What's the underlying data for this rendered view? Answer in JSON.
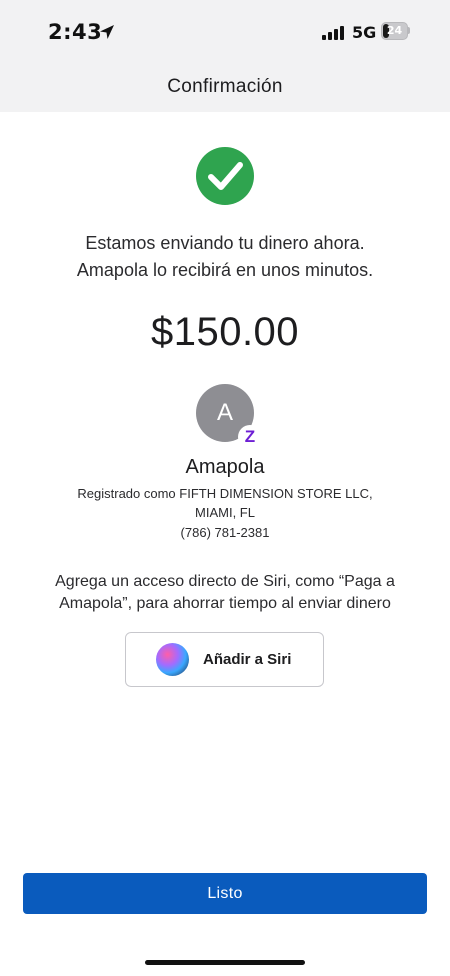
{
  "status_bar": {
    "time": "2:43",
    "network": "5G",
    "battery_level": "24",
    "battery_fraction": 0.24,
    "icons": [
      "location-arrow-icon",
      "signal-bars-icon",
      "battery-icon"
    ]
  },
  "header": {
    "title": "Confirmación"
  },
  "confirmation": {
    "icon": "checkmark-circle-icon",
    "accent_color": "#2fa44f",
    "message_line1": "Estamos enviando tu dinero ahora.",
    "message_line2": "Amapola lo recibirá en unos minutos.",
    "amount": "$150.00"
  },
  "recipient": {
    "avatar_initial": "A",
    "badge": "Z",
    "badge_color": "#6d1ed4",
    "name": "Amapola",
    "registered_line1": "Registrado como FIFTH DIMENSION STORE LLC,",
    "registered_line2": "MIAMI, FL",
    "phone": "(786) 781-2381"
  },
  "siri": {
    "prompt_line1": "Agrega un acceso directo de Siri, como “Paga a",
    "prompt_line2": "Amapola”, para ahorrar tiempo al enviar dinero",
    "button_label": "Añadir a Siri",
    "icon": "siri-orb-icon"
  },
  "footer": {
    "done_label": "Listo",
    "button_color": "#0a5bbd"
  }
}
